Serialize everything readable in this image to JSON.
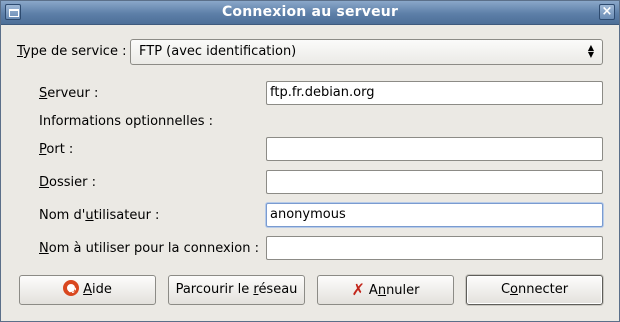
{
  "window": {
    "title": "Connexion au serveur",
    "close_glyph": "×"
  },
  "service": {
    "label_mnemonic": "T",
    "label_rest": "ype de service :",
    "value": "FTP (avec identification)"
  },
  "form": {
    "server": {
      "mnemonic": "S",
      "rest": "erveur :",
      "value": "ftp.fr.debian.org"
    },
    "optional_heading": "Informations optionnelles :",
    "port": {
      "mnemonic": "P",
      "rest": "ort :",
      "value": ""
    },
    "folder": {
      "mnemonic": "D",
      "rest": "ossier :",
      "value": ""
    },
    "username": {
      "before": "Nom d'",
      "mnemonic": "u",
      "rest": "tilisateur :",
      "value": "anonymous"
    },
    "connection_name": {
      "mnemonic": "N",
      "rest": "om à utiliser pour la connexion :",
      "value": ""
    }
  },
  "buttons": {
    "help": {
      "mnemonic": "A",
      "rest": "ide",
      "icon": "help-lifebuoy-icon"
    },
    "browse": {
      "before": "Parcourir le ",
      "mnemonic": "r",
      "rest": "éseau"
    },
    "cancel": {
      "mnemonic": "n",
      "before": "A",
      "rest": "nuler",
      "icon": "cancel-x-icon"
    },
    "connect": {
      "before": "C",
      "mnemonic": "o",
      "rest": "nnecter"
    }
  }
}
